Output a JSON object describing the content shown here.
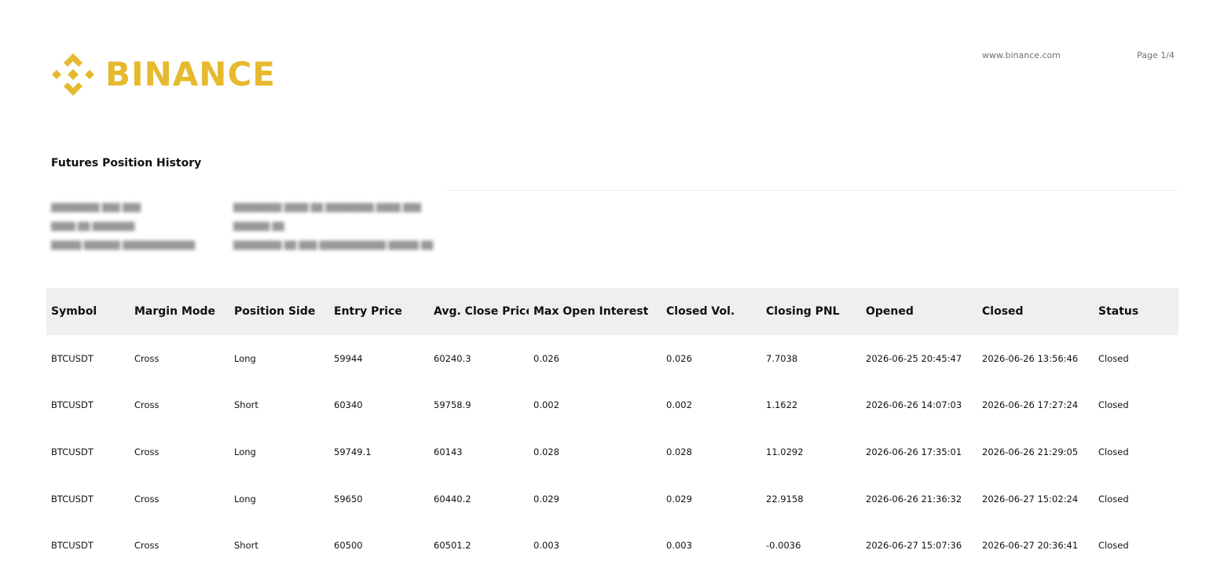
{
  "brand": {
    "name": "BINANCE",
    "color": "#E6B92E",
    "icon": "binance-diamond-icon"
  },
  "header": {
    "website": "www.binance.com",
    "page": "Page 1/4"
  },
  "title": "Futures Position History",
  "table": {
    "columns": [
      "Symbol",
      "Margin Mode",
      "Position Side",
      "Entry Price",
      "Avg. Close Price",
      "Max Open Interest",
      "Closed Vol.",
      "Closing PNL",
      "Opened",
      "Closed",
      "Status"
    ],
    "rows": [
      [
        "BTCUSDT",
        "Cross",
        "Long",
        "59944",
        "60240.3",
        "0.026",
        "0.026",
        "7.7038",
        "2026-06-25 20:45:47",
        "2026-06-26 13:56:46",
        "Closed"
      ],
      [
        "BTCUSDT",
        "Cross",
        "Short",
        "60340",
        "59758.9",
        "0.002",
        "0.002",
        "1.1622",
        "2026-06-26 14:07:03",
        "2026-06-26 17:27:24",
        "Closed"
      ],
      [
        "BTCUSDT",
        "Cross",
        "Long",
        "59749.1",
        "60143",
        "0.028",
        "0.028",
        "11.0292",
        "2026-06-26 17:35:01",
        "2026-06-26 21:29:05",
        "Closed"
      ],
      [
        "BTCUSDT",
        "Cross",
        "Long",
        "59650",
        "60440.2",
        "0.029",
        "0.029",
        "22.9158",
        "2026-06-26 21:36:32",
        "2026-06-27 15:02:24",
        "Closed"
      ],
      [
        "BTCUSDT",
        "Cross",
        "Short",
        "60500",
        "60501.2",
        "0.003",
        "0.003",
        "-0.0036",
        "2026-06-27 15:07:36",
        "2026-06-27 20:36:41",
        "Closed"
      ]
    ]
  }
}
